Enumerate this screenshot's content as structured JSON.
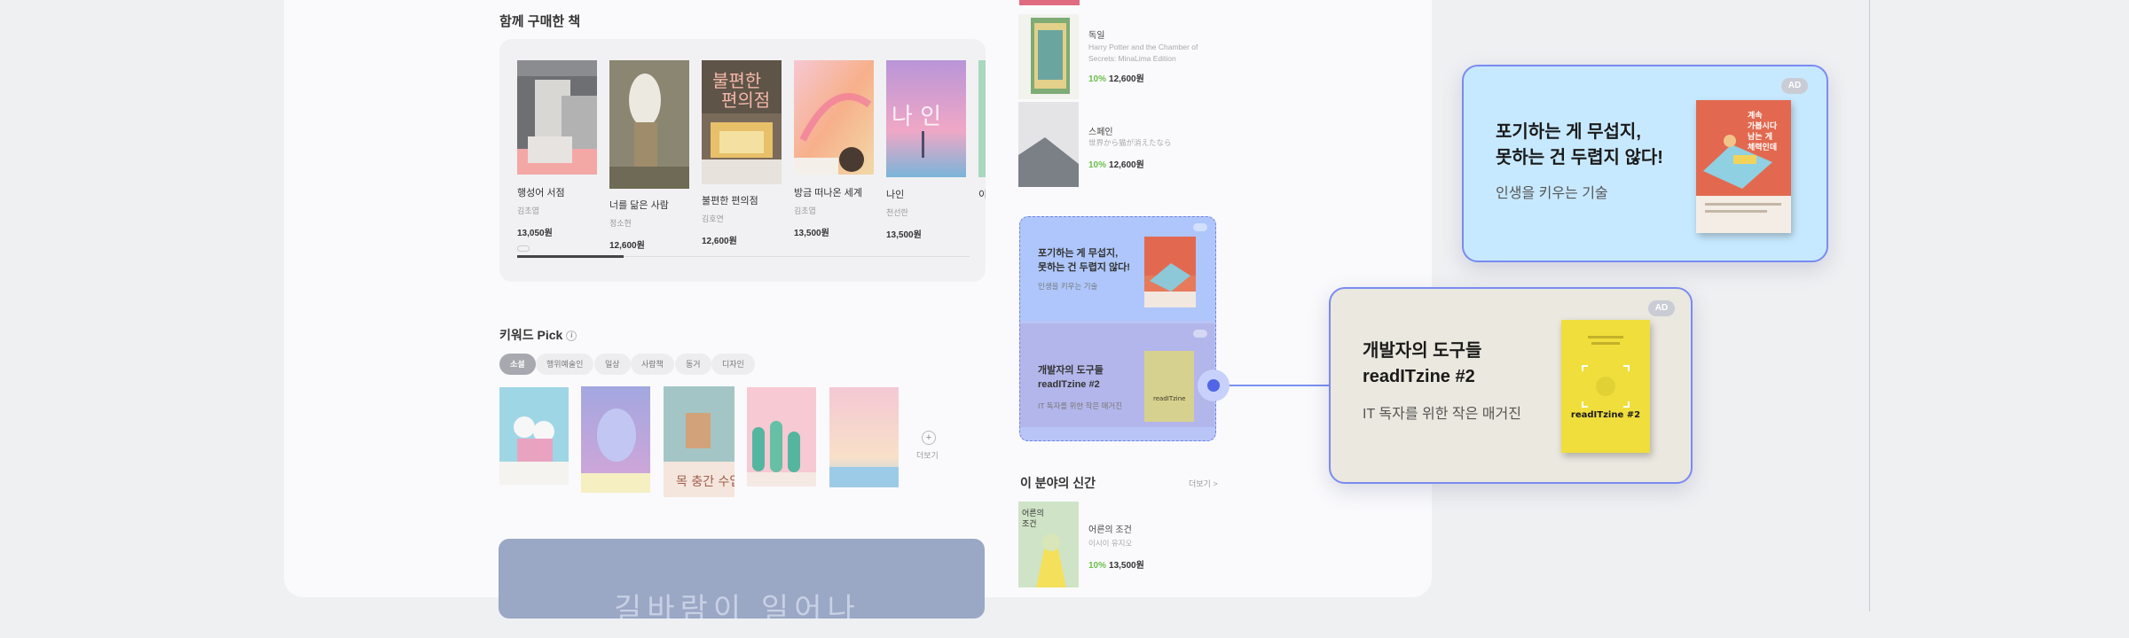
{
  "together": {
    "title": "함께 구매한 책",
    "books": [
      {
        "title": "행성어 서점",
        "author": "김초엽",
        "price": "13,050원",
        "cover_text": "행성어 서점"
      },
      {
        "title": "너를 닮은 사람",
        "author": "정소현",
        "price": "12,600원",
        "cover_text": "너를 닮은 사람"
      },
      {
        "title": "불편한 편의점",
        "author": "김호연",
        "price": "12,600원",
        "cover_text": "불편한 편의점"
      },
      {
        "title": "방금 떠나온 세계",
        "author": "김초엽",
        "price": "13,500원",
        "cover_text": "방금 떠나온 세계"
      },
      {
        "title": "나인",
        "author": "천선란",
        "price": "13,500원",
        "cover_text": "나 인"
      },
      {
        "title": "이",
        "author": "",
        "price": "",
        "cover_text": ""
      }
    ]
  },
  "keyword": {
    "title": "키워드 Pick",
    "info": "i",
    "chips": [
      "소설",
      "행위예술인",
      "일상",
      "사람책",
      "동거",
      "디자인"
    ],
    "more": "더보기",
    "more_icon": "+"
  },
  "bottom_banner": {
    "text": "길바람이 일어나"
  },
  "right_column": {
    "items": [
      {
        "lang": "독일",
        "sub": "Harry Potter and the Chamber of Secrets: MinaLima Edition",
        "discount": "10%",
        "price": "12,600원"
      },
      {
        "lang": "스페인",
        "sub": "世界から猫が消えたなら",
        "discount": "10%",
        "price": "12,600원"
      }
    ],
    "new_section": {
      "title": "이 분야의 신간",
      "more": "더보기 >",
      "book": {
        "title": "어른의 조건",
        "author": "이시이 유지오",
        "discount": "10%",
        "price": "13,500원",
        "cover_text": "어른의 조건"
      }
    }
  },
  "mini_ads": [
    {
      "title_line1": "포기하는 게 무섭지,",
      "title_line2": "못하는 건 두렵지 않다!",
      "sub": "인생을 키우는 기술"
    },
    {
      "title_line1": "개발자의 도구들",
      "title_line2": "readITzine #2",
      "sub": "IT 독자를 위한 작은 매거진"
    }
  ],
  "ad_cards": [
    {
      "badge": "AD",
      "title_line1": "포기하는 게 무섭지,",
      "title_line2": "못하는 건 두렵지 않다!",
      "sub": "인생을 키우는 기술",
      "cover_text": "계속 가봅시다 남는 게 체력인데"
    },
    {
      "badge": "AD",
      "title_line1": "개발자의 도구들",
      "title_line2": "readITzine #2",
      "sub": "IT 독자를 위한 작은 매거진",
      "cover_text": "readITzine #2"
    }
  ]
}
